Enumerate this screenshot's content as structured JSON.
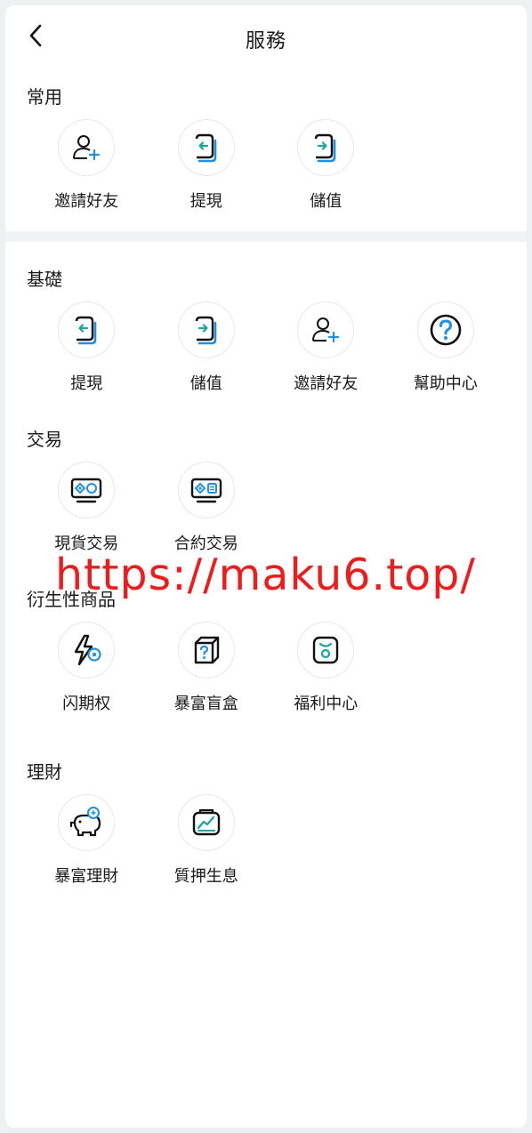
{
  "header": {
    "title": "服務",
    "back_icon": "chevron-left-icon"
  },
  "sections": [
    {
      "title": "常用",
      "items": [
        {
          "label": "邀請好友",
          "icon": "user-add-icon"
        },
        {
          "label": "提現",
          "icon": "withdraw-icon"
        },
        {
          "label": "儲值",
          "icon": "deposit-icon"
        }
      ]
    },
    {
      "title": "基礎",
      "items": [
        {
          "label": "提現",
          "icon": "withdraw-icon"
        },
        {
          "label": "儲值",
          "icon": "deposit-icon"
        },
        {
          "label": "邀請好友",
          "icon": "user-add-icon"
        },
        {
          "label": "幫助中心",
          "icon": "help-icon"
        }
      ]
    },
    {
      "title": "交易",
      "items": [
        {
          "label": "現貨交易",
          "icon": "spot-trading-icon"
        },
        {
          "label": "合約交易",
          "icon": "contract-trading-icon"
        }
      ]
    },
    {
      "title": "衍生性商品",
      "items": [
        {
          "label": "闪期权",
          "icon": "flash-option-icon"
        },
        {
          "label": "暴富盲盒",
          "icon": "mystery-box-icon"
        },
        {
          "label": "福利中心",
          "icon": "welfare-icon"
        }
      ]
    },
    {
      "title": "理財",
      "items": [
        {
          "label": "暴富理財",
          "icon": "piggy-bank-icon"
        },
        {
          "label": "質押生息",
          "icon": "staking-chart-icon"
        }
      ]
    }
  ],
  "watermark": "https://maku6.top/",
  "colors": {
    "accent": "#1e90e6",
    "icon_dark": "#111111",
    "divider": "#f2f3f5",
    "watermark": "#ee1c1c"
  }
}
